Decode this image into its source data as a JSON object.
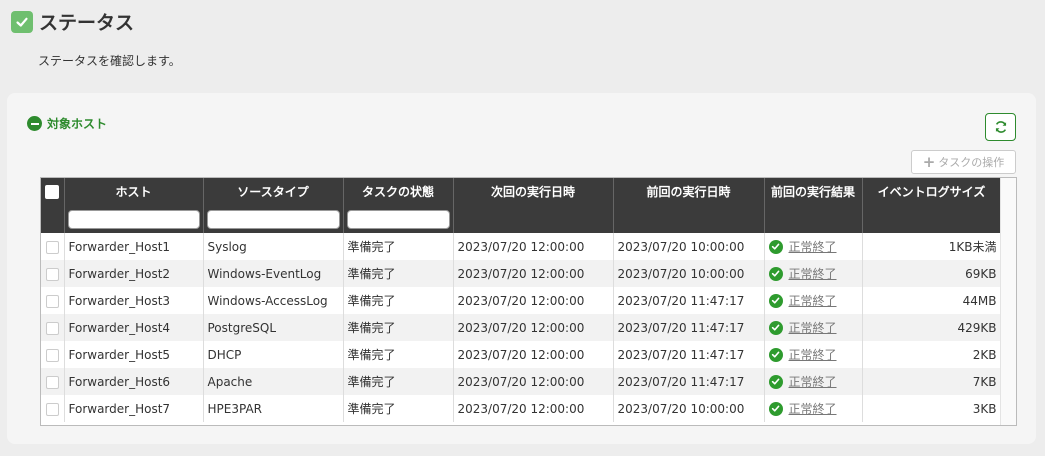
{
  "page": {
    "title": "ステータス",
    "description": "ステータスを確認します。"
  },
  "section": {
    "title": "対象ホスト",
    "task_button_label": "タスクの操作"
  },
  "table": {
    "headers": {
      "host": "ホスト",
      "source_type": "ソースタイプ",
      "task_state": "タスクの状態",
      "next_run": "次回の実行日時",
      "last_run": "前回の実行日時",
      "last_result": "前回の実行結果",
      "event_log_size": "イベントログサイズ"
    },
    "filters": {
      "host": "",
      "source_type": "",
      "task_state": ""
    },
    "rows": [
      {
        "host": "Forwarder_Host1",
        "source_type": "Syslog",
        "task_state": "準備完了",
        "next_run": "2023/07/20 12:00:00",
        "last_run": "2023/07/20 10:00:00",
        "last_result": "正常終了",
        "size": "1KB未満"
      },
      {
        "host": "Forwarder_Host2",
        "source_type": "Windows-EventLog",
        "task_state": "準備完了",
        "next_run": "2023/07/20 12:00:00",
        "last_run": "2023/07/20 10:00:00",
        "last_result": "正常終了",
        "size": "69KB"
      },
      {
        "host": "Forwarder_Host3",
        "source_type": "Windows-AccessLog",
        "task_state": "準備完了",
        "next_run": "2023/07/20 12:00:00",
        "last_run": "2023/07/20 11:47:17",
        "last_result": "正常終了",
        "size": "44MB"
      },
      {
        "host": "Forwarder_Host4",
        "source_type": "PostgreSQL",
        "task_state": "準備完了",
        "next_run": "2023/07/20 12:00:00",
        "last_run": "2023/07/20 11:47:17",
        "last_result": "正常終了",
        "size": "429KB"
      },
      {
        "host": "Forwarder_Host5",
        "source_type": "DHCP",
        "task_state": "準備完了",
        "next_run": "2023/07/20 12:00:00",
        "last_run": "2023/07/20 11:47:17",
        "last_result": "正常終了",
        "size": "2KB"
      },
      {
        "host": "Forwarder_Host6",
        "source_type": "Apache",
        "task_state": "準備完了",
        "next_run": "2023/07/20 12:00:00",
        "last_run": "2023/07/20 11:47:17",
        "last_result": "正常終了",
        "size": "7KB"
      },
      {
        "host": "Forwarder_Host7",
        "source_type": "HPE3PAR",
        "task_state": "準備完了",
        "next_run": "2023/07/20 12:00:00",
        "last_run": "2023/07/20 10:00:00",
        "last_result": "正常終了",
        "size": "3KB"
      }
    ]
  },
  "colors": {
    "accent": "#2e8b2e",
    "header_bg": "#3b3b3b",
    "title_check": "#6fbf6f"
  },
  "icons": {
    "title": "check-icon",
    "section": "minus-circle-icon",
    "refresh": "refresh-icon",
    "task": "plus-icon",
    "result": "check-circle-icon"
  }
}
